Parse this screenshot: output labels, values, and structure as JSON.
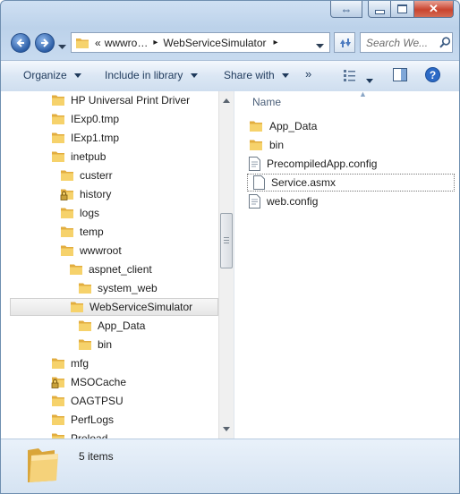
{
  "window": {
    "caption": {
      "back_glyph": "⇔",
      "min_glyph": "",
      "max_glyph": "",
      "close_glyph": "✕"
    }
  },
  "address": {
    "overflow": "«",
    "crumbs": [
      "wwwro…",
      "WebServiceSimulator"
    ],
    "separator": "▸"
  },
  "search": {
    "placeholder": "Search We..."
  },
  "toolbar": {
    "organize": "Organize",
    "include_in_library": "Include in library",
    "share_with": "Share with",
    "more": "»"
  },
  "tree": {
    "items": [
      {
        "label": "HP Universal Print Driver",
        "indent": 0,
        "locked": false,
        "selected": false
      },
      {
        "label": "IExp0.tmp",
        "indent": 0,
        "locked": false,
        "selected": false
      },
      {
        "label": "IExp1.tmp",
        "indent": 0,
        "locked": false,
        "selected": false
      },
      {
        "label": "inetpub",
        "indent": 0,
        "locked": false,
        "selected": false
      },
      {
        "label": "custerr",
        "indent": 1,
        "locked": false,
        "selected": false
      },
      {
        "label": "history",
        "indent": 1,
        "locked": true,
        "selected": false
      },
      {
        "label": "logs",
        "indent": 1,
        "locked": false,
        "selected": false
      },
      {
        "label": "temp",
        "indent": 1,
        "locked": false,
        "selected": false
      },
      {
        "label": "wwwroot",
        "indent": 1,
        "locked": false,
        "selected": false
      },
      {
        "label": "aspnet_client",
        "indent": 2,
        "locked": false,
        "selected": false
      },
      {
        "label": "system_web",
        "indent": 3,
        "locked": false,
        "selected": false
      },
      {
        "label": "WebServiceSimulator",
        "indent": 2,
        "locked": false,
        "selected": true
      },
      {
        "label": "App_Data",
        "indent": 3,
        "locked": false,
        "selected": false
      },
      {
        "label": "bin",
        "indent": 3,
        "locked": false,
        "selected": false
      },
      {
        "label": "mfg",
        "indent": 0,
        "locked": false,
        "selected": false
      },
      {
        "label": "MSOCache",
        "indent": 0,
        "locked": true,
        "selected": false
      },
      {
        "label": "OAGTPSU",
        "indent": 0,
        "locked": false,
        "selected": false
      },
      {
        "label": "PerfLogs",
        "indent": 0,
        "locked": false,
        "selected": false
      },
      {
        "label": "Preload",
        "indent": 0,
        "locked": false,
        "selected": false
      }
    ]
  },
  "content": {
    "column_name": "Name",
    "files": [
      {
        "name": "App_Data",
        "type": "folder"
      },
      {
        "name": "bin",
        "type": "folder"
      },
      {
        "name": "PrecompiledApp.config",
        "type": "config"
      },
      {
        "name": "Service.asmx",
        "type": "blank"
      },
      {
        "name": "web.config",
        "type": "config"
      }
    ],
    "focused_index": 3
  },
  "status": {
    "item_count": "5 items"
  },
  "colors": {
    "accent": "#2c5ea6",
    "folder": "#f2c94c",
    "selection": "#e6e6e6"
  }
}
